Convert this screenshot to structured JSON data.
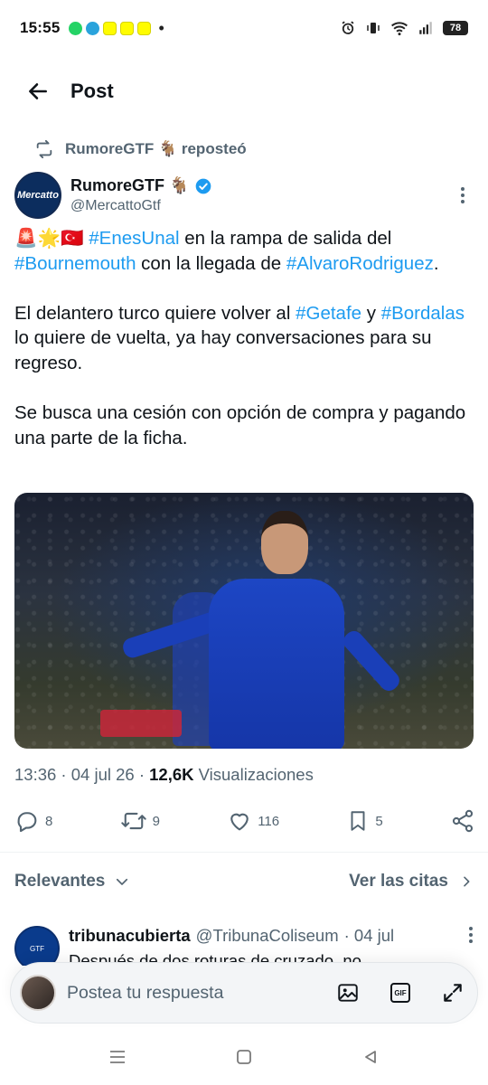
{
  "status_bar": {
    "time": "15:55",
    "battery": "78",
    "more": "•"
  },
  "header": {
    "title": "Post"
  },
  "repost": {
    "name": "RumoreGTF 🐐",
    "action": "reposteó"
  },
  "author": {
    "name": "RumoreGTF 🐐",
    "handle": "@MercattoGtf",
    "verified": true,
    "avatar_text": "Mercatto"
  },
  "tweet": {
    "p1_emojis": "🚨🌟🇹🇷 ",
    "p1_tag1": "#EnesUnal",
    "p1_text1": " en la rampa de salida del ",
    "p1_tag2": "#Bournemouth",
    "p1_text2": " con la llegada de ",
    "p1_tag3": "#AlvaroRodriguez",
    "p1_text3": ".",
    "p2_text1": "El delantero turco quiere volver al ",
    "p2_tag1": "#Getafe",
    "p2_text2": " y ",
    "p2_tag2": "#Bordalas",
    "p2_text3": " lo quiere de vuelta, ya hay conversaciones para su regreso.",
    "p3_text": "Se busca una cesión con opción de compra y pagando una parte de la ficha."
  },
  "meta": {
    "time_date": "13:36 · 04 jul 26 · ",
    "views_count": "12,6K",
    "views_label": " Visualizaciones"
  },
  "actions": {
    "replies": "8",
    "reposts": "9",
    "likes": "116",
    "bookmarks": "5"
  },
  "replies_section": {
    "sort_label": "Relevantes",
    "quotes_link": "Ver las citas"
  },
  "reply": {
    "name": "tribunacubierta",
    "handle": "@TribunaColiseum",
    "date": "· 04 jul",
    "text": "Después de dos roturas de cruzado, no"
  },
  "composer": {
    "placeholder": "Postea tu respuesta",
    "gif_label": "GIF"
  },
  "colors": {
    "accent": "#1d9bf0",
    "text": "#0f1419",
    "muted": "#536471"
  }
}
